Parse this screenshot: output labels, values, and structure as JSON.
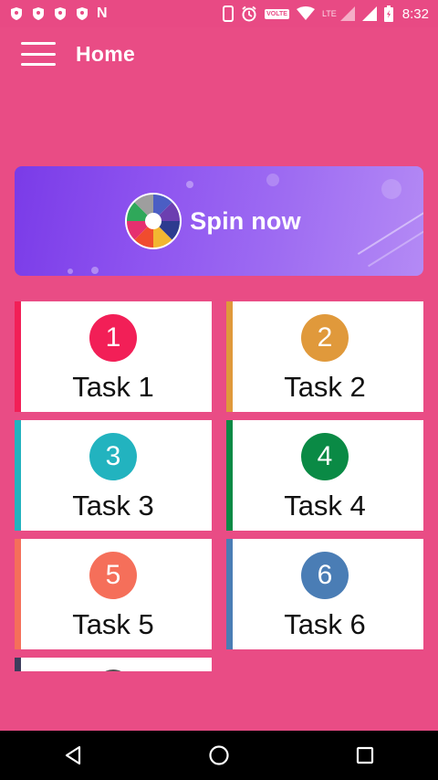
{
  "status_bar": {
    "network_label": "N",
    "volte_label": "VOLTE",
    "lte_label": "LTE",
    "time": "8:32"
  },
  "app_bar": {
    "title": "Home",
    "menu_icon": "hamburger-menu-icon"
  },
  "banner": {
    "label": "Spin now",
    "icon": "spin-wheel-icon"
  },
  "tasks": [
    {
      "number": "1",
      "label": "Task 1",
      "color": "#F21F57"
    },
    {
      "number": "2",
      "label": "Task 2",
      "color": "#E0993B"
    },
    {
      "number": "3",
      "label": "Task 3",
      "color": "#22B3BF"
    },
    {
      "number": "4",
      "label": "Task 4",
      "color": "#0A8A45"
    },
    {
      "number": "5",
      "label": "Task 5",
      "color": "#F56F5A"
    },
    {
      "number": "6",
      "label": "Task 6",
      "color": "#4A7DB5"
    }
  ],
  "nav_bar": {
    "back_icon": "back-triangle-icon",
    "home_icon": "home-circle-icon",
    "recents_icon": "recents-square-icon"
  },
  "colors": {
    "background": "#E94C85",
    "card": "#FFFFFF",
    "banner_start": "#7A3BE8",
    "banner_end": "#B48AF5"
  }
}
